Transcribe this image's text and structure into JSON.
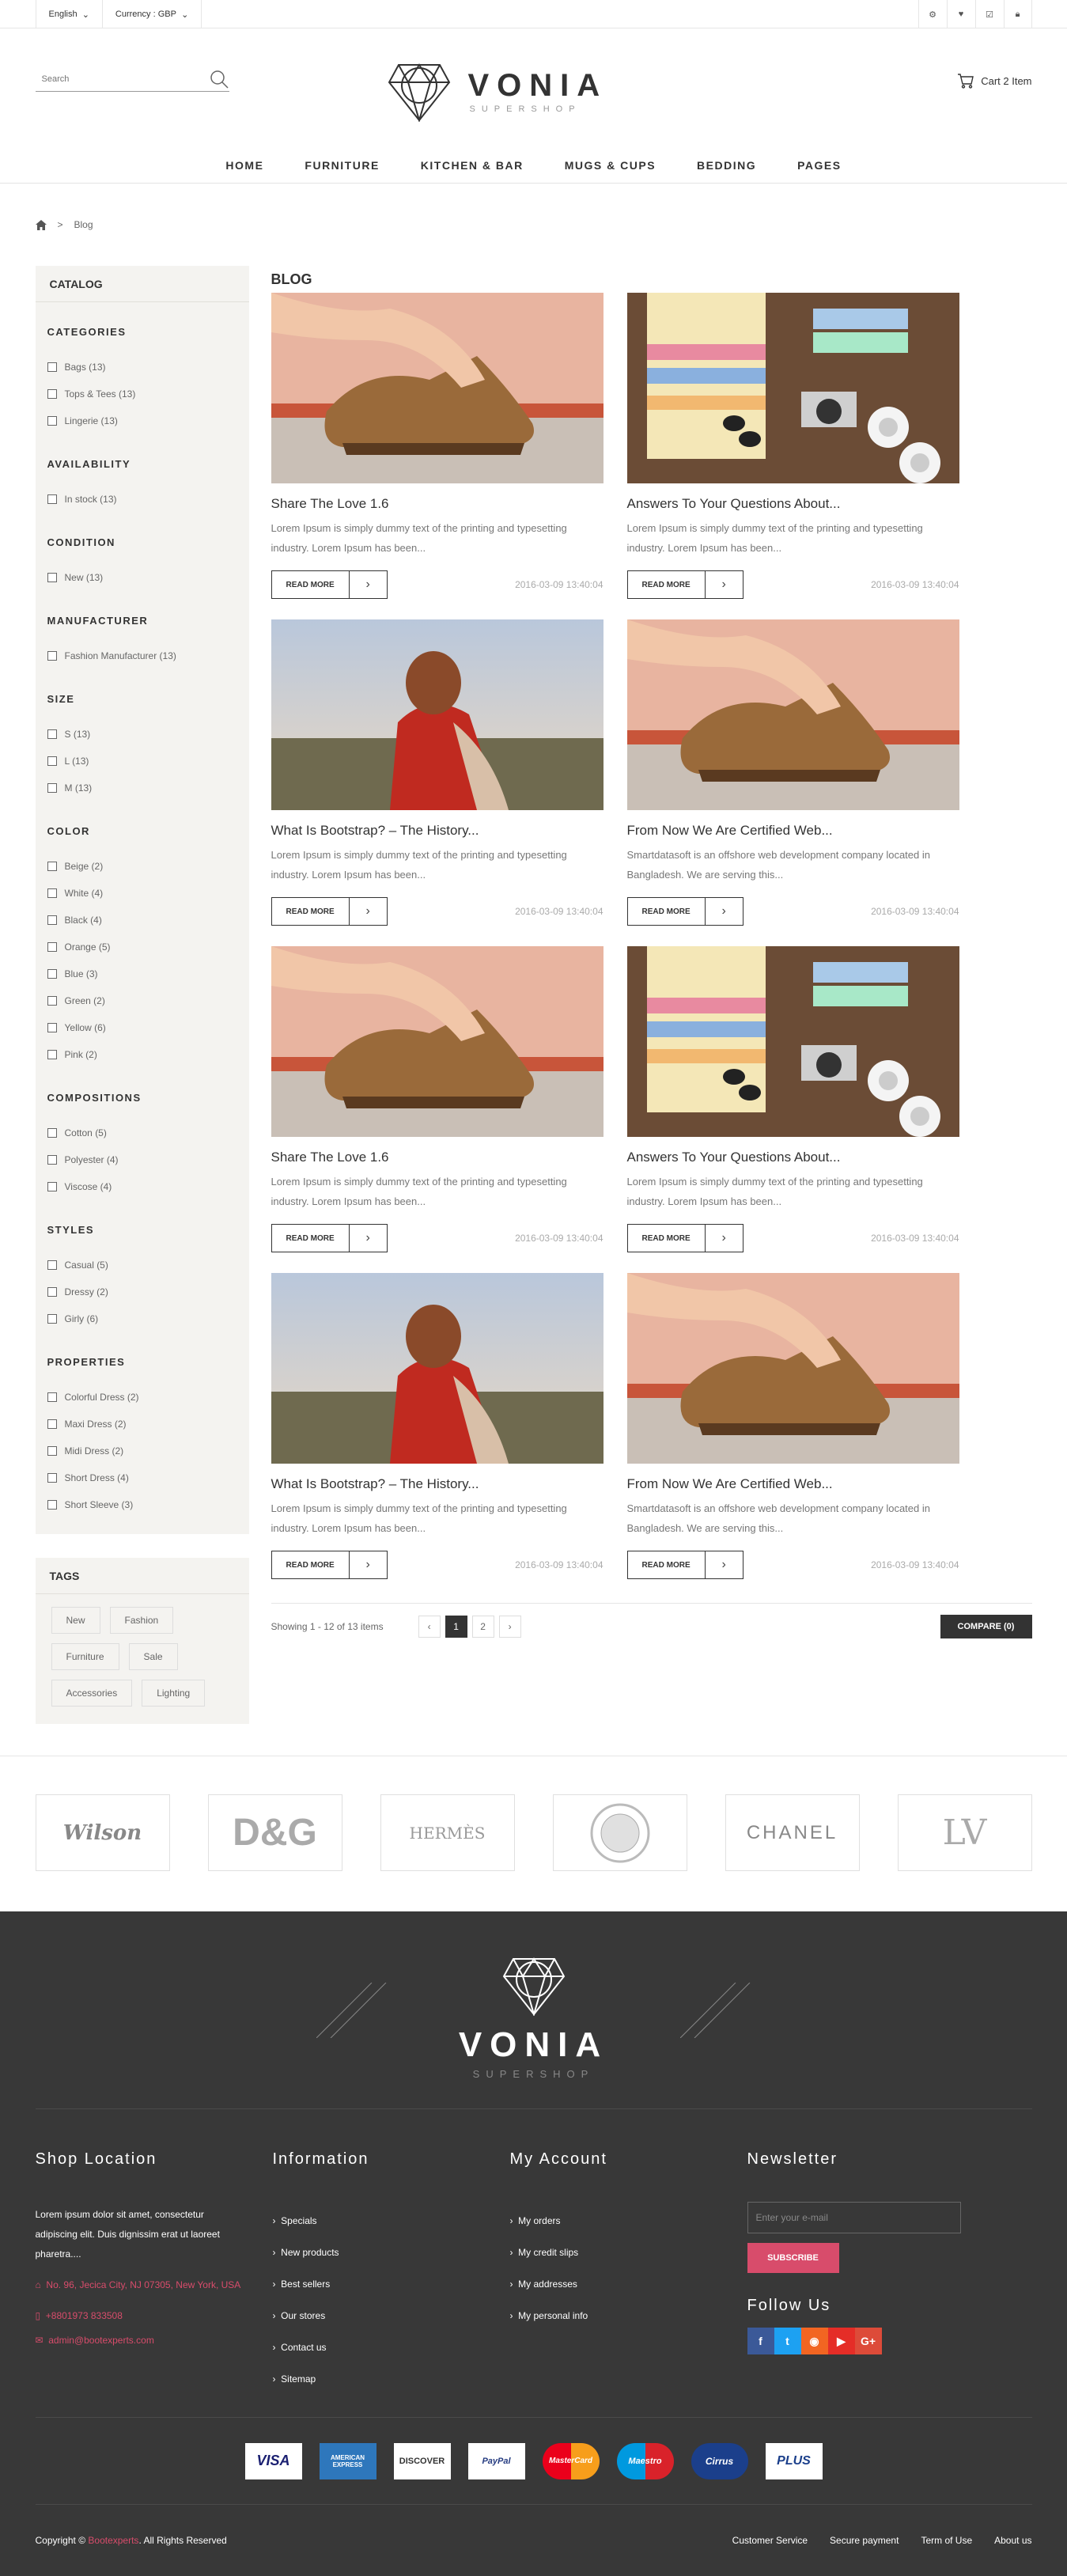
{
  "topbar": {
    "language": "English",
    "currency": "Currency : GBP"
  },
  "search": {
    "placeholder": "Search"
  },
  "logo": {
    "name": "VONIA",
    "tagline": "SUPERSHOP"
  },
  "cart": {
    "label": "Cart 2 Item"
  },
  "nav": [
    "HOME",
    "FURNITURE",
    "KITCHEN & BAR",
    "MUGS & CUPS",
    "BEDDING",
    "PAGES"
  ],
  "breadcrumb": {
    "separator": ">",
    "current": "Blog"
  },
  "catalog": {
    "title": "CATALOG",
    "groups": [
      {
        "name": "CATEGORIES",
        "items": [
          "Bags (13)",
          "Tops & Tees (13)",
          "Lingerie (13)"
        ]
      },
      {
        "name": "AVAILABILITY",
        "items": [
          "In stock (13)"
        ]
      },
      {
        "name": "CONDITION",
        "items": [
          "New (13)"
        ]
      },
      {
        "name": "MANUFACTURER",
        "items": [
          "Fashion Manufacturer (13)"
        ]
      },
      {
        "name": "SIZE",
        "items": [
          "S (13)",
          "L (13)",
          "M (13)"
        ]
      },
      {
        "name": "COLOR",
        "items": [
          "Beige (2)",
          "White (4)",
          "Black (4)",
          "Orange (5)",
          "Blue (3)",
          "Green (2)",
          "Yellow (6)",
          "Pink (2)"
        ]
      },
      {
        "name": "COMPOSITIONS",
        "items": [
          "Cotton (5)",
          "Polyester (4)",
          "Viscose (4)"
        ]
      },
      {
        "name": "STYLES",
        "items": [
          "Casual (5)",
          "Dressy (2)",
          "Girly (6)"
        ]
      },
      {
        "name": "PROPERTIES",
        "items": [
          "Colorful Dress (2)",
          "Maxi Dress (2)",
          "Midi Dress (2)",
          "Short Dress (4)",
          "Short Sleeve (3)"
        ]
      }
    ]
  },
  "tags": {
    "title": "TAGS",
    "items": [
      "New",
      "Fashion",
      "Furniture",
      "Sale",
      "Accessories",
      "Lighting"
    ]
  },
  "blog": {
    "heading": "BLOG",
    "read_more": "READ MORE",
    "posts": [
      {
        "title": "Share The Love 1.6",
        "excerpt": "Lorem Ipsum is simply dummy text of the printing and typesetting industry. Lorem Ipsum has been...",
        "date": "2016-03-09 13:40:04",
        "image": "shoe"
      },
      {
        "title": "Answers To Your Questions About...",
        "excerpt": "Lorem Ipsum is simply dummy text of the printing and typesetting industry. Lorem Ipsum has been...",
        "date": "2016-03-09 13:40:04",
        "image": "flatlay"
      },
      {
        "title": "What Is Bootstrap? – The History...",
        "excerpt": "Lorem Ipsum is simply dummy text of the printing and typesetting industry. Lorem Ipsum has been...",
        "date": "2016-03-09 13:40:04",
        "image": "girl"
      },
      {
        "title": "From Now We Are Certified Web...",
        "excerpt": "Smartdatasoft is an offshore web development company located in Bangladesh. We are serving this...",
        "date": "2016-03-09 13:40:04",
        "image": "shoe"
      },
      {
        "title": "Share The Love 1.6",
        "excerpt": "Lorem Ipsum is simply dummy text of the printing and typesetting industry. Lorem Ipsum has been...",
        "date": "2016-03-09 13:40:04",
        "image": "shoe"
      },
      {
        "title": "Answers To Your Questions About...",
        "excerpt": "Lorem Ipsum is simply dummy text of the printing and typesetting industry. Lorem Ipsum has been...",
        "date": "2016-03-09 13:40:04",
        "image": "flatlay"
      },
      {
        "title": "What Is Bootstrap? – The History...",
        "excerpt": "Lorem Ipsum is simply dummy text of the printing and typesetting industry. Lorem Ipsum has been...",
        "date": "2016-03-09 13:40:04",
        "image": "girl"
      },
      {
        "title": "From Now We Are Certified Web...",
        "excerpt": "Smartdatasoft is an offshore web development company located in Bangladesh. We are serving this...",
        "date": "2016-03-09 13:40:04",
        "image": "shoe"
      }
    ]
  },
  "pagination": {
    "showing": "Showing 1 - 12 of 13 items",
    "prev": "‹",
    "pages": [
      "1",
      "2"
    ],
    "next": "›",
    "compare": "COMPARE (0)"
  },
  "brands": [
    "Wilson",
    "D&G",
    "HERMÈS",
    "VERSACE",
    "CHANEL",
    "LOUIS VUITTON"
  ],
  "footer": {
    "logo": {
      "name": "VONIA",
      "tagline": "SUPERSHOP"
    },
    "shop": {
      "title": "Shop Location",
      "text": "Lorem ipsum dolor sit amet, consectetur adipiscing elit. Duis dignissim erat ut laoreet pharetra....",
      "address": "No. 96, Jecica City, NJ 07305, New York, USA",
      "phone": "+8801973 833508",
      "email": "admin@bootexperts.com"
    },
    "information": {
      "title": "Information",
      "items": [
        "Specials",
        "New products",
        "Best sellers",
        "Our stores",
        "Contact us",
        "Sitemap"
      ]
    },
    "account": {
      "title": "My Account",
      "items": [
        "My orders",
        "My credit slips",
        "My addresses",
        "My personal info"
      ]
    },
    "newsletter": {
      "title": "Newsletter",
      "placeholder": "Enter your e-mail",
      "button": "SUBSCRIBE",
      "follow": "Follow Us"
    },
    "payments": [
      "VISA",
      "AMERICAN EXPRESS",
      "DISCOVER",
      "PayPal",
      "MasterCard",
      "Maestro",
      "Cirrus",
      "PLUS"
    ],
    "copyright_prefix": "Copyright ©",
    "copyright_brand": "Bootexperts",
    "copyright_suffix": ". All Rights Reserved",
    "links": [
      "Customer Service",
      "Secure payment",
      "Term of Use",
      "About us"
    ]
  },
  "colors": {
    "accent": "#d84c6b",
    "dark": "#383838",
    "sidebar_bg": "#f4f3f0"
  }
}
